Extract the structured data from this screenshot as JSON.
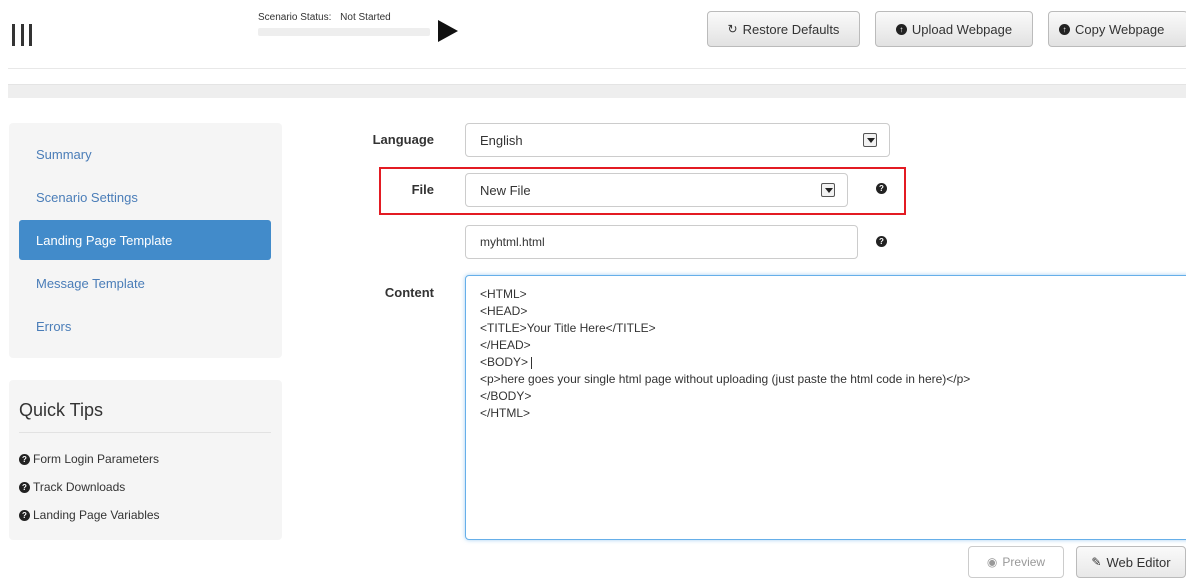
{
  "header": {
    "status_label": "Scenario Status:",
    "status_value": "Not Started",
    "buttons": [
      {
        "label": "Restore Defaults",
        "icon": "refresh-icon"
      },
      {
        "label": "Upload Webpage",
        "icon": "upload-icon"
      },
      {
        "label": "Copy Webpage",
        "icon": "copy-icon"
      }
    ]
  },
  "sidebar": {
    "items": [
      {
        "label": "Summary",
        "active": false
      },
      {
        "label": "Scenario Settings",
        "active": false
      },
      {
        "label": "Landing Page Template",
        "active": true
      },
      {
        "label": "Message Template",
        "active": false
      },
      {
        "label": "Errors",
        "active": false
      }
    ]
  },
  "tips": {
    "title": "Quick Tips",
    "items": [
      "Form Login Parameters",
      "Track Downloads",
      "Landing Page Variables"
    ]
  },
  "form": {
    "language_label": "Language",
    "language_value": "English",
    "file_label": "File",
    "file_value": "New File",
    "filename_value": "myhtml.html",
    "content_label": "Content",
    "content_lines": [
      "<HTML>",
      "<HEAD>",
      "<TITLE>Your Title Here</TITLE>",
      "</HEAD>",
      "<BODY>",
      "<p>here goes your single html page without uploading (just paste the html code in here)</p>",
      "</BODY>",
      "</HTML>"
    ]
  },
  "footer": {
    "preview_label": "Preview",
    "web_editor_label": "Web Editor"
  },
  "colors": {
    "accent": "#428bca",
    "link": "#4a7db8",
    "highlight": "#e31b23"
  }
}
